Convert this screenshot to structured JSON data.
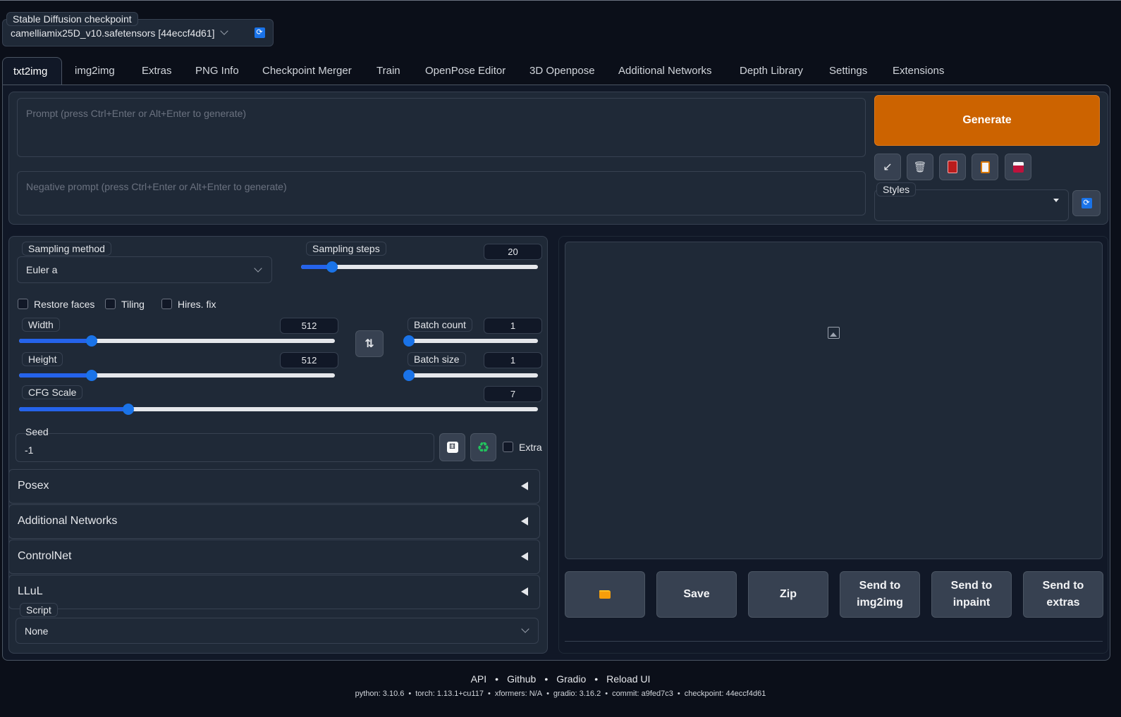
{
  "checkpoint": {
    "label": "Stable Diffusion checkpoint",
    "value": "camelliamix25D_v10.safetensors [44eccf4d61]",
    "refresh_icon": "refresh-icon"
  },
  "tabs": [
    "txt2img",
    "img2img",
    "Extras",
    "PNG Info",
    "Checkpoint Merger",
    "Train",
    "OpenPose Editor",
    "3D Openpose",
    "Additional Networks",
    "Depth Library",
    "Settings",
    "Extensions"
  ],
  "prompt": {
    "placeholder": "Prompt (press Ctrl+Enter or Alt+Enter to generate)",
    "negative_placeholder": "Negative prompt (press Ctrl+Enter or Alt+Enter to generate)"
  },
  "generate": {
    "label": "Generate",
    "color": "#cc6300"
  },
  "tool_icons": [
    "arrow-icon",
    "trash-icon",
    "card-icon",
    "clipboard-icon",
    "save-icon"
  ],
  "styles": {
    "label": "Styles",
    "value": ""
  },
  "sampling": {
    "method_label": "Sampling method",
    "method_value": "Euler a",
    "steps_label": "Sampling steps",
    "steps_value": "20",
    "steps_fraction": 0.13
  },
  "checkboxes": {
    "restore_faces": "Restore faces",
    "tiling": "Tiling",
    "hires_fix": "Hires. fix"
  },
  "width": {
    "label": "Width",
    "value": "512",
    "fraction": 0.23
  },
  "height": {
    "label": "Height",
    "value": "512",
    "fraction": 0.23
  },
  "batch_count": {
    "label": "Batch count",
    "value": "1",
    "fraction": 0.0
  },
  "batch_size": {
    "label": "Batch size",
    "value": "1",
    "fraction": 0.0
  },
  "cfg": {
    "label": "CFG Scale",
    "value": "7",
    "fraction": 0.21
  },
  "seed": {
    "label": "Seed",
    "value": "-1",
    "extra_label": "Extra"
  },
  "accordions": [
    "Posex",
    "Additional Networks",
    "ControlNet",
    "LLuL"
  ],
  "script": {
    "label": "Script",
    "value": "None"
  },
  "actions": {
    "folder_icon": "folder-icon",
    "save": "Save",
    "zip": "Zip",
    "send_img2img": "Send to img2img",
    "send_inpaint": "Send to inpaint",
    "send_extras": "Send to extras"
  },
  "footer": {
    "links": [
      "API",
      "Github",
      "Gradio",
      "Reload UI"
    ],
    "versions": [
      "python: 3.10.6",
      "torch: 1.13.1+cu117",
      "xformers: N/A",
      "gradio: 3.16.2",
      "commit: a9fed7c3",
      "checkpoint: 44eccf4d61"
    ]
  }
}
